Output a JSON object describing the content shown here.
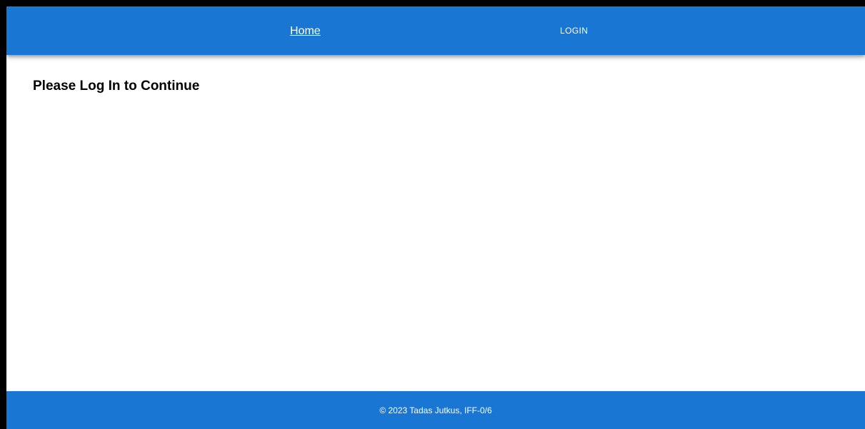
{
  "colors": {
    "primary": "#1976d2",
    "surface": "#ffffff",
    "text_on_primary": "#ffffff",
    "text": "#000000",
    "outer_border": "#000000"
  },
  "header": {
    "home_link": "Home",
    "login_button": "LOGIN"
  },
  "main": {
    "title": "Please Log In to Continue"
  },
  "footer": {
    "text": "© 2023 Tadas Jutkus, IFF-0/6"
  }
}
